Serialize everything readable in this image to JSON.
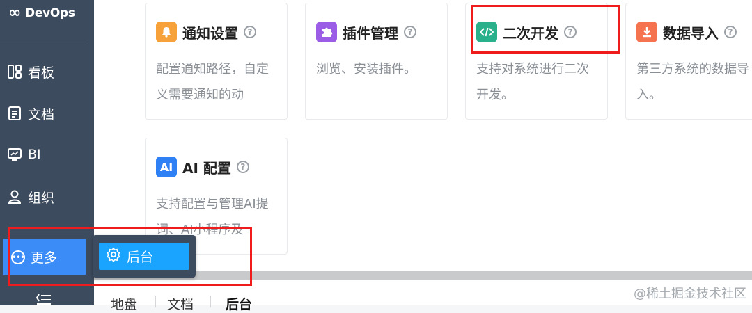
{
  "brand": {
    "name": "DevOps",
    "icon": "infinity-icon"
  },
  "nav": [
    {
      "label": "看板",
      "icon": "kanban-icon"
    },
    {
      "label": "文档",
      "icon": "document-icon"
    },
    {
      "label": "BI",
      "icon": "monitor-icon"
    },
    {
      "label": "组织",
      "icon": "user-icon"
    }
  ],
  "more": {
    "label": "更多",
    "icon": "more-dots-icon"
  },
  "popup": {
    "item_label": "后台",
    "icon": "gear-icon"
  },
  "cards": [
    {
      "title": "通知设置",
      "desc": "配置通知路径，自定义需要通知的动",
      "icon": "bell-icon",
      "color": "#f7a13a"
    },
    {
      "title": "插件管理",
      "desc": "浏览、安装插件。",
      "icon": "puzzle-icon",
      "color": "#9b5de5"
    },
    {
      "title": "二次开发",
      "desc": "支持对系统进行二次开发。",
      "icon": "code-icon",
      "color": "#2ab08a"
    },
    {
      "title": "数据导入",
      "desc": "第三方系统的数据导入。",
      "icon": "download-icon",
      "color": "#f5734f"
    },
    {
      "title": "AI 配置",
      "desc": "支持配置与管理AI提词、AI小程序及",
      "icon": "ai-icon",
      "icon_text": "AI",
      "color": "#2f7ff5"
    }
  ],
  "tabs": [
    "地盘",
    "文档",
    "后台"
  ],
  "watermark": "@稀土掘金技术社区",
  "colors": {
    "sidebar": "#3d4b5e",
    "accent": "#3b8cf7",
    "popup_item": "#1aa3ff",
    "highlight": "#ee1c1c"
  }
}
